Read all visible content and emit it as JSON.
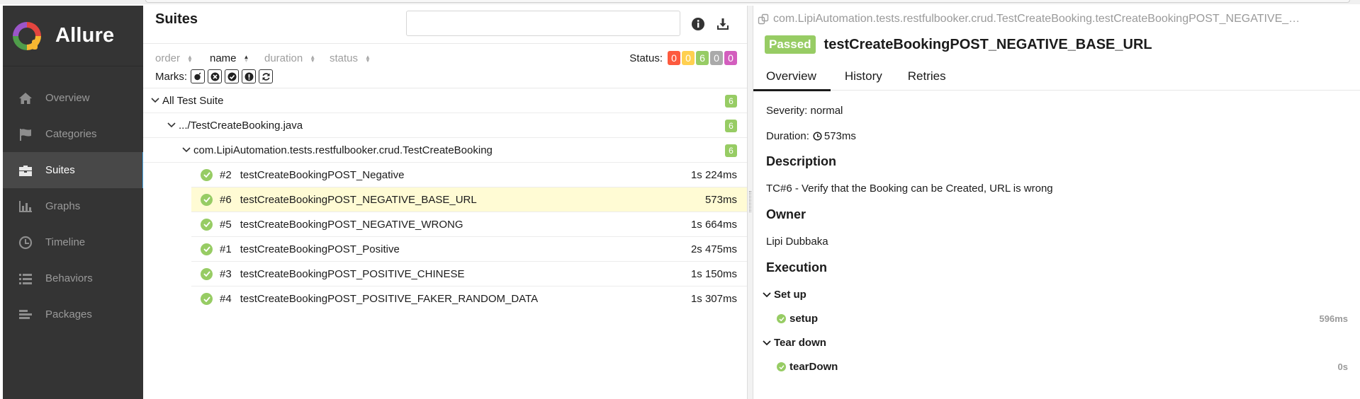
{
  "sidebar": {
    "brand": "Allure",
    "items": [
      {
        "label": "Overview",
        "icon": "home-icon"
      },
      {
        "label": "Categories",
        "icon": "flag-icon"
      },
      {
        "label": "Suites",
        "icon": "briefcase-icon",
        "active": true
      },
      {
        "label": "Graphs",
        "icon": "bar-chart-icon"
      },
      {
        "label": "Timeline",
        "icon": "clock-icon"
      },
      {
        "label": "Behaviors",
        "icon": "list-icon"
      },
      {
        "label": "Packages",
        "icon": "align-left-icon"
      }
    ]
  },
  "suites": {
    "title": "Suites",
    "search_value": "",
    "sort": [
      "order",
      "name",
      "duration",
      "status"
    ],
    "status_label": "Status:",
    "status_counts": [
      {
        "value": "0",
        "color": "#fd5a3e"
      },
      {
        "value": "0",
        "color": "#ffd050"
      },
      {
        "value": "6",
        "color": "#97cc64"
      },
      {
        "value": "0",
        "color": "#aaaaaa"
      },
      {
        "value": "0",
        "color": "#d35ebe"
      }
    ],
    "marks_label": "Marks:",
    "tree": {
      "root": {
        "label": "All Test Suite",
        "count": "6"
      },
      "file": {
        "label": ".../TestCreateBooking.java",
        "count": "6"
      },
      "class": {
        "label": "com.LipiAutomation.tests.restfulbooker.crud.TestCreateBooking",
        "count": "6"
      },
      "tests": [
        {
          "order": "#2",
          "name": "testCreateBookingPOST_Negative",
          "duration": "1s 224ms"
        },
        {
          "order": "#6",
          "name": "testCreateBookingPOST_NEGATIVE_BASE_URL",
          "duration": "573ms"
        },
        {
          "order": "#5",
          "name": "testCreateBookingPOST_NEGATIVE_WRONG",
          "duration": "1s 664ms"
        },
        {
          "order": "#1",
          "name": "testCreateBookingPOST_Positive",
          "duration": "2s 475ms"
        },
        {
          "order": "#3",
          "name": "testCreateBookingPOST_POSITIVE_CHINESE",
          "duration": "1s 150ms"
        },
        {
          "order": "#4",
          "name": "testCreateBookingPOST_POSITIVE_FAKER_RANDOM_DATA",
          "duration": "1s 307ms"
        }
      ]
    }
  },
  "detail": {
    "breadcrumb": "com.LipiAutomation.tests.restfulbooker.crud.TestCreateBooking.testCreateBookingPOST_NEGATIVE_…",
    "status": "Passed",
    "title": "testCreateBookingPOST_NEGATIVE_BASE_URL",
    "tabs": [
      "Overview",
      "History",
      "Retries"
    ],
    "severity": "Severity: normal",
    "duration_label": "Duration:",
    "duration_value": "573ms",
    "description_heading": "Description",
    "description": "TC#6 - Verify that the Booking can be Created, URL is wrong",
    "owner_heading": "Owner",
    "owner": "Lipi Dubbaka",
    "execution_heading": "Execution",
    "setup_heading": "Set up",
    "setup_step": {
      "name": "setup",
      "duration": "596ms"
    },
    "teardown_heading": "Tear down",
    "teardown_step": {
      "name": "tearDown",
      "duration": "0s"
    }
  }
}
